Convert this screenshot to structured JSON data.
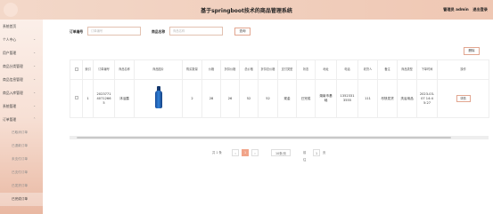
{
  "header": {
    "title": "基于springboot技术的商品管理系统",
    "admin_label": "管理员 admin",
    "logout_label": "退出登录"
  },
  "sidebar": {
    "items": [
      {
        "label": "系统首页",
        "chevron": ""
      },
      {
        "label": "个人中心",
        "chevron": "⌄"
      },
      {
        "label": "用户管理",
        "chevron": "⌄"
      },
      {
        "label": "商品分类管理",
        "chevron": "⌄"
      },
      {
        "label": "商品信息管理",
        "chevron": "⌄"
      },
      {
        "label": "商品入库管理",
        "chevron": "⌄"
      },
      {
        "label": "系统管理",
        "chevron": "⌄"
      },
      {
        "label": "订单管理",
        "chevron": "⌃"
      }
    ],
    "subitems": [
      {
        "label": "已取消订单"
      },
      {
        "label": "已退款订单"
      },
      {
        "label": "未支付订单"
      },
      {
        "label": "已支付订单"
      },
      {
        "label": "已发货订单"
      },
      {
        "label": "已完成订单"
      }
    ]
  },
  "search": {
    "order_no_label": "订单编号",
    "order_no_placeholder": "订单编号",
    "product_name_label": "商品名称",
    "product_name_placeholder": "商品名称",
    "search_button": "查询"
  },
  "toolbar": {
    "delete_button": "删除"
  },
  "table": {
    "headers": [
      "",
      "索引",
      "订单编号",
      "商品名称",
      "商品图片",
      "购买数量",
      "价格",
      "折扣价格",
      "总价格",
      "折扣总价格",
      "支付类型",
      "状态",
      "地址",
      "电话",
      "收货人",
      "备注",
      "商品类型",
      "下单时间",
      "操作"
    ],
    "rows": [
      {
        "index": "1",
        "order_no": "202377140712665",
        "product_name": "沐浴露",
        "quantity": "2",
        "price": "28",
        "discount_price": "26",
        "total_price": "52",
        "discount_total": "52",
        "payment_type": "现金",
        "status": "已完成",
        "address": "湖南市基础",
        "phone": "13523313555",
        "receiver": "111",
        "remark": "尽快发货",
        "product_type": "洗浴用品",
        "order_time": "2023-03-07 14:45:27",
        "action": "详情"
      }
    ]
  },
  "pagination": {
    "total": "共 1 条",
    "prev": "‹",
    "current": "1",
    "next": "›",
    "page_size": "10条/页",
    "goto_label": "前往",
    "goto_value": "1",
    "page_unit": "页"
  },
  "colors": {
    "accent": "#f1a489",
    "header_bg": "#f3d8c9"
  }
}
